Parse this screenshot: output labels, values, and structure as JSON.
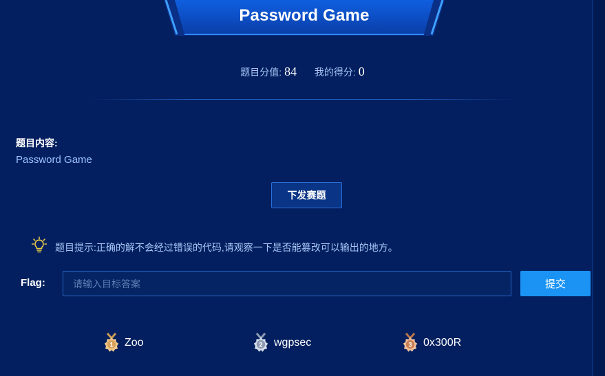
{
  "header": {
    "title": "Password Game"
  },
  "score": {
    "value_label": "题目分值:",
    "value": "84",
    "my_label": "我的得分:",
    "my_value": "0"
  },
  "content": {
    "label": "题目内容:",
    "text": "Password Game"
  },
  "issue_button": {
    "label": "下发赛题"
  },
  "hint": {
    "icon": "lightbulb-icon",
    "text": "题目提示:正确的解不会经过错误的代码,请观察一下是否能篡改可以输出的地方。"
  },
  "flag": {
    "label": "Flag:",
    "placeholder": "请输入目标答案",
    "value": ""
  },
  "submit_button": {
    "label": "提交"
  },
  "leaderboard": [
    {
      "rank": "1",
      "name": "Zoo",
      "medal": "gold-medal-icon"
    },
    {
      "rank": "2",
      "name": "wgpsec",
      "medal": "silver-medal-icon"
    },
    {
      "rank": "3",
      "name": "0x300R",
      "medal": "bronze-medal-icon"
    }
  ],
  "colors": {
    "background": "#031f5f",
    "accent": "#1a93f5",
    "gold": "#e8b86a",
    "silver": "#b8c4d6",
    "bronze": "#d99a6c"
  }
}
